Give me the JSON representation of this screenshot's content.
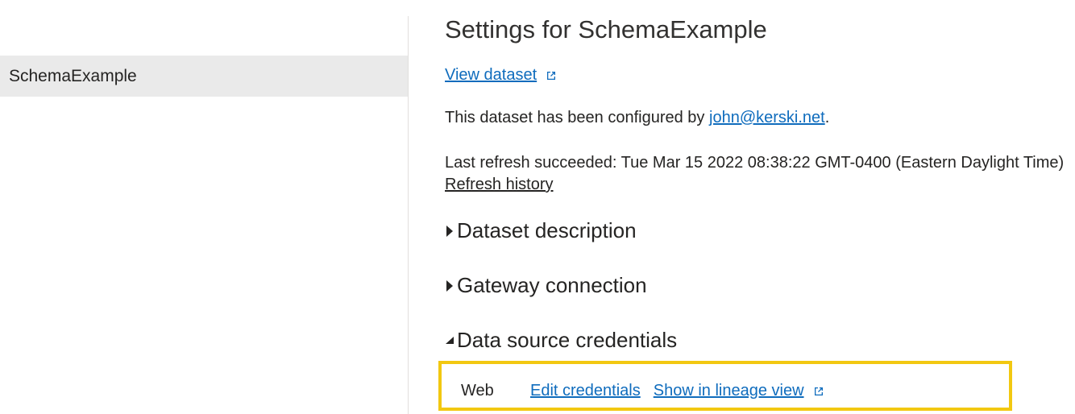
{
  "sidebar": {
    "items": [
      {
        "label": "SchemaExample",
        "selected": true
      }
    ]
  },
  "main": {
    "title": "Settings for SchemaExample",
    "view_dataset_label": "View dataset",
    "configured_prefix": "This dataset has been configured by ",
    "configured_email": "john@kerski.net",
    "configured_suffix": ".",
    "refresh_status": "Last refresh succeeded: Tue Mar 15 2022 08:38:22 GMT-0400 (Eastern Daylight Time)",
    "refresh_history_label": "Refresh history",
    "sections": [
      {
        "label": "Dataset description",
        "expanded": false
      },
      {
        "label": "Gateway connection",
        "expanded": false
      },
      {
        "label": "Data source credentials",
        "expanded": true
      }
    ],
    "credentials": {
      "type": "Web",
      "edit_label": "Edit credentials",
      "lineage_label": "Show in lineage view"
    }
  },
  "colors": {
    "link": "#0f6cbd",
    "highlight_border": "#f2c811",
    "selected_bg": "#eaeaea"
  }
}
